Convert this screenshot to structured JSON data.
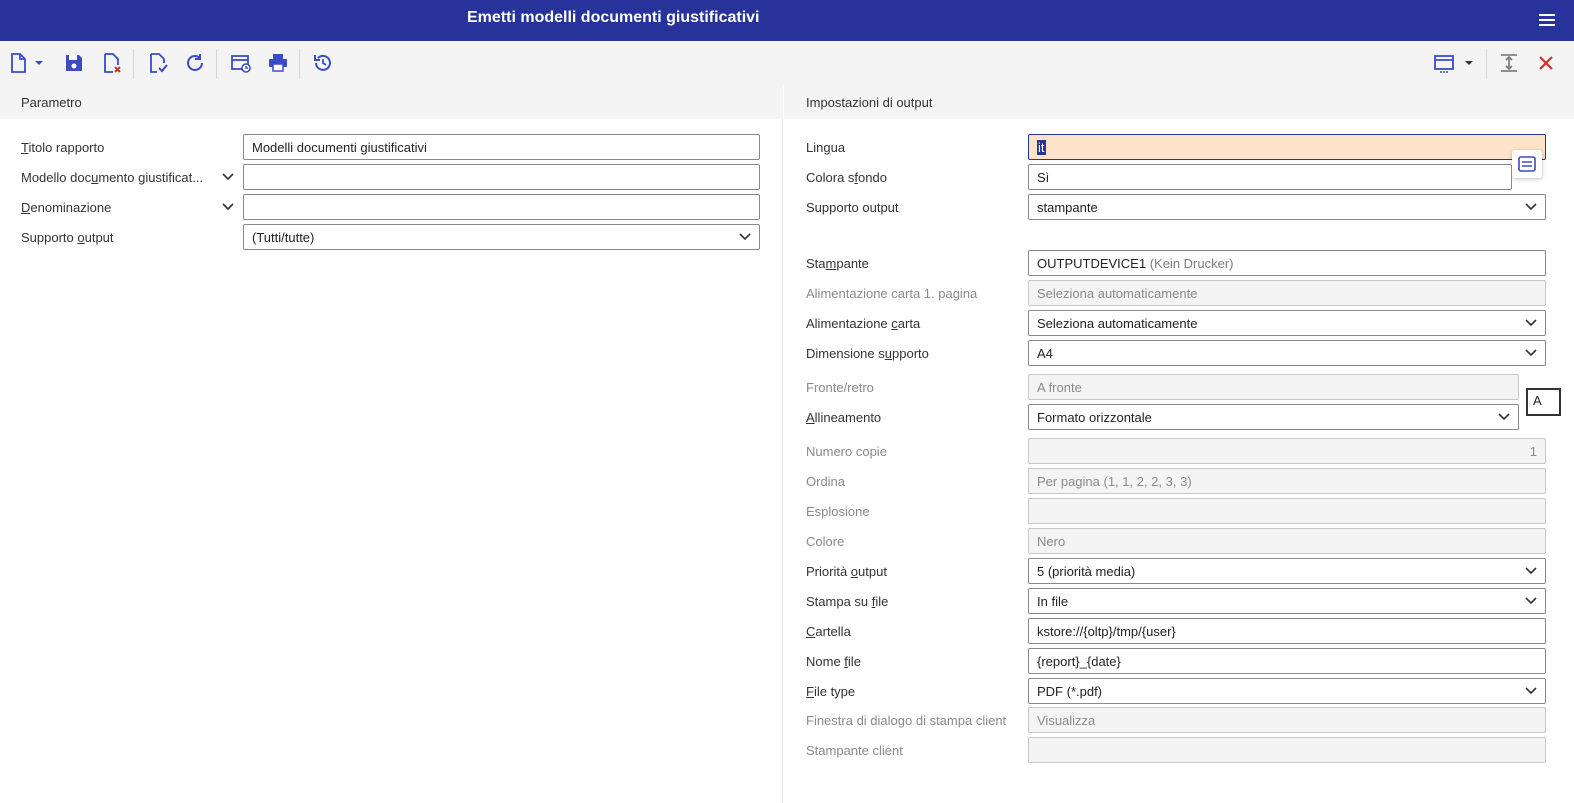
{
  "window": {
    "title": "Emetti modelli documenti giustificativi"
  },
  "left": {
    "header": "Parametro",
    "fields": [
      {
        "label_pre": "",
        "label_u": "T",
        "label_post": "itolo rapporto",
        "value": "Modelli documenti giustificativi",
        "type": "text"
      },
      {
        "label_pre": "Modello doc",
        "label_u": "u",
        "label_post": "mento giustificat...",
        "value": "",
        "type": "lookup"
      },
      {
        "label_pre": "",
        "label_u": "D",
        "label_post": "enominazione",
        "value": "",
        "type": "lookup"
      },
      {
        "label_pre": "Supporto ",
        "label_u": "o",
        "label_post": "utput",
        "value": "(Tutti/tutte)",
        "type": "select"
      }
    ]
  },
  "right": {
    "header": "Impostazioni di output",
    "lingua": {
      "label_pre": "Lin",
      "label_u": "g",
      "label_post": "ua",
      "value": "it"
    },
    "colora": {
      "label_pre": "Colora s",
      "label_u": "f",
      "label_post": "ondo",
      "value": "Sì"
    },
    "supporto": {
      "label_pre": "Supporto output",
      "label_u": "",
      "label_post": "",
      "value": "stampante"
    },
    "stampante": {
      "label_pre": "Sta",
      "label_u": "m",
      "label_post": "pante",
      "value": "OUTPUTDEVICE1",
      "note": "(Kein Drucker)"
    },
    "alim1": {
      "label": "Alimentazione carta 1. pagina",
      "value": "Seleziona automaticamente"
    },
    "alim": {
      "label_pre": "Alimentazione ",
      "label_u": "c",
      "label_post": "arta",
      "value": "Seleziona automaticamente"
    },
    "dimensione": {
      "label_pre": "Dimensione s",
      "label_u": "u",
      "label_post": "pporto",
      "value": "A4"
    },
    "fronte": {
      "label": "Fronte/retro",
      "value": "A fronte"
    },
    "allineamento": {
      "label_pre": "",
      "label_u": "A",
      "label_post": "llineamento",
      "value": "Formato orizzontale"
    },
    "numero": {
      "label": "Numero copie",
      "value": "1"
    },
    "ordina": {
      "label": "Ordina",
      "value": "Per pagina (1, 1, 2, 2, 3, 3)"
    },
    "esplosione": {
      "label": "Esplosione",
      "value": ""
    },
    "colore": {
      "label": "Colore",
      "value": "Nero"
    },
    "priorita": {
      "label_pre": "Priorità ",
      "label_u": "o",
      "label_post": "utput",
      "value": "5 (priorità media)"
    },
    "stampafile": {
      "label_pre": "Stampa su ",
      "label_u": "f",
      "label_post": "ile",
      "value": "In file"
    },
    "cartella": {
      "label_pre": "",
      "label_u": "C",
      "label_post": "artella",
      "value": "kstore://{oltp}/tmp/{user}"
    },
    "nomefile": {
      "label_pre": "Nome ",
      "label_u": "f",
      "label_post": "ile",
      "value": "{report}_{date}"
    },
    "filetype": {
      "label_pre": "",
      "label_u": "F",
      "label_post": "ile type",
      "value": "PDF (*.pdf)"
    },
    "finestra": {
      "label": "Finestra di dialogo di stampa client",
      "value": "Visualizza"
    },
    "stampclient": {
      "label": "Stampante client",
      "value": ""
    },
    "side_box_value": "A"
  },
  "colors": {
    "titlebar": "#27339b",
    "accent": "#3a4bc4",
    "highlight": "#fde3c8"
  },
  "toolbar_icons": [
    "new-document-icon",
    "dropdown-icon",
    "save-icon",
    "discard-icon",
    "validate-icon",
    "refresh-icon",
    "schedule-icon",
    "print-icon",
    "history-icon",
    "view-icon",
    "dropdown-icon",
    "expand-icon",
    "close-icon"
  ]
}
